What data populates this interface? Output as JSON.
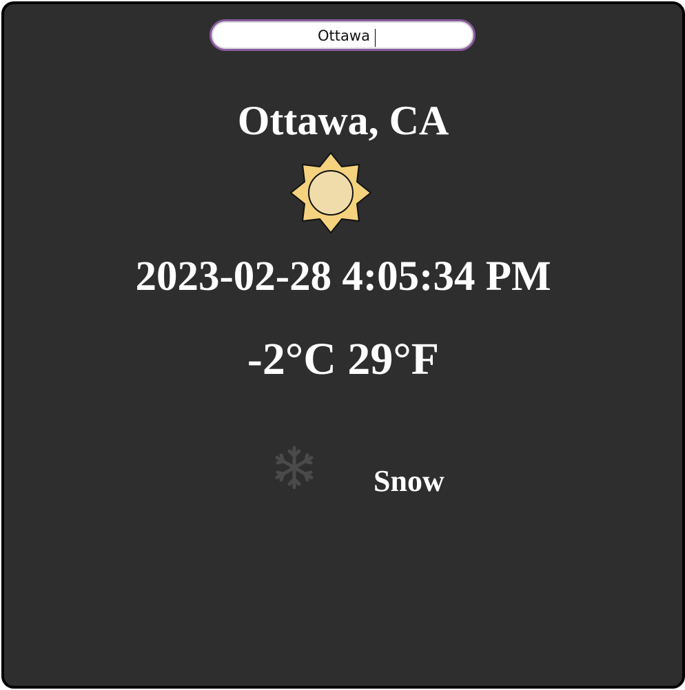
{
  "search": {
    "value": "Ottawa"
  },
  "location": {
    "display": "Ottawa, CA"
  },
  "weather": {
    "main_icon": "sun-icon",
    "datetime": "2023-02-28 4:05:34 PM",
    "temperature": "-2°C 29°F",
    "condition_icon": "snowflake-icon",
    "condition": "Snow"
  },
  "colors": {
    "background": "#2e2e2e",
    "text": "#ffffff",
    "search_border": "#8a5a9e",
    "sun_fill": "#f5d27e",
    "sun_center": "#f0dcab",
    "snowflake": "#4a4a4a"
  }
}
